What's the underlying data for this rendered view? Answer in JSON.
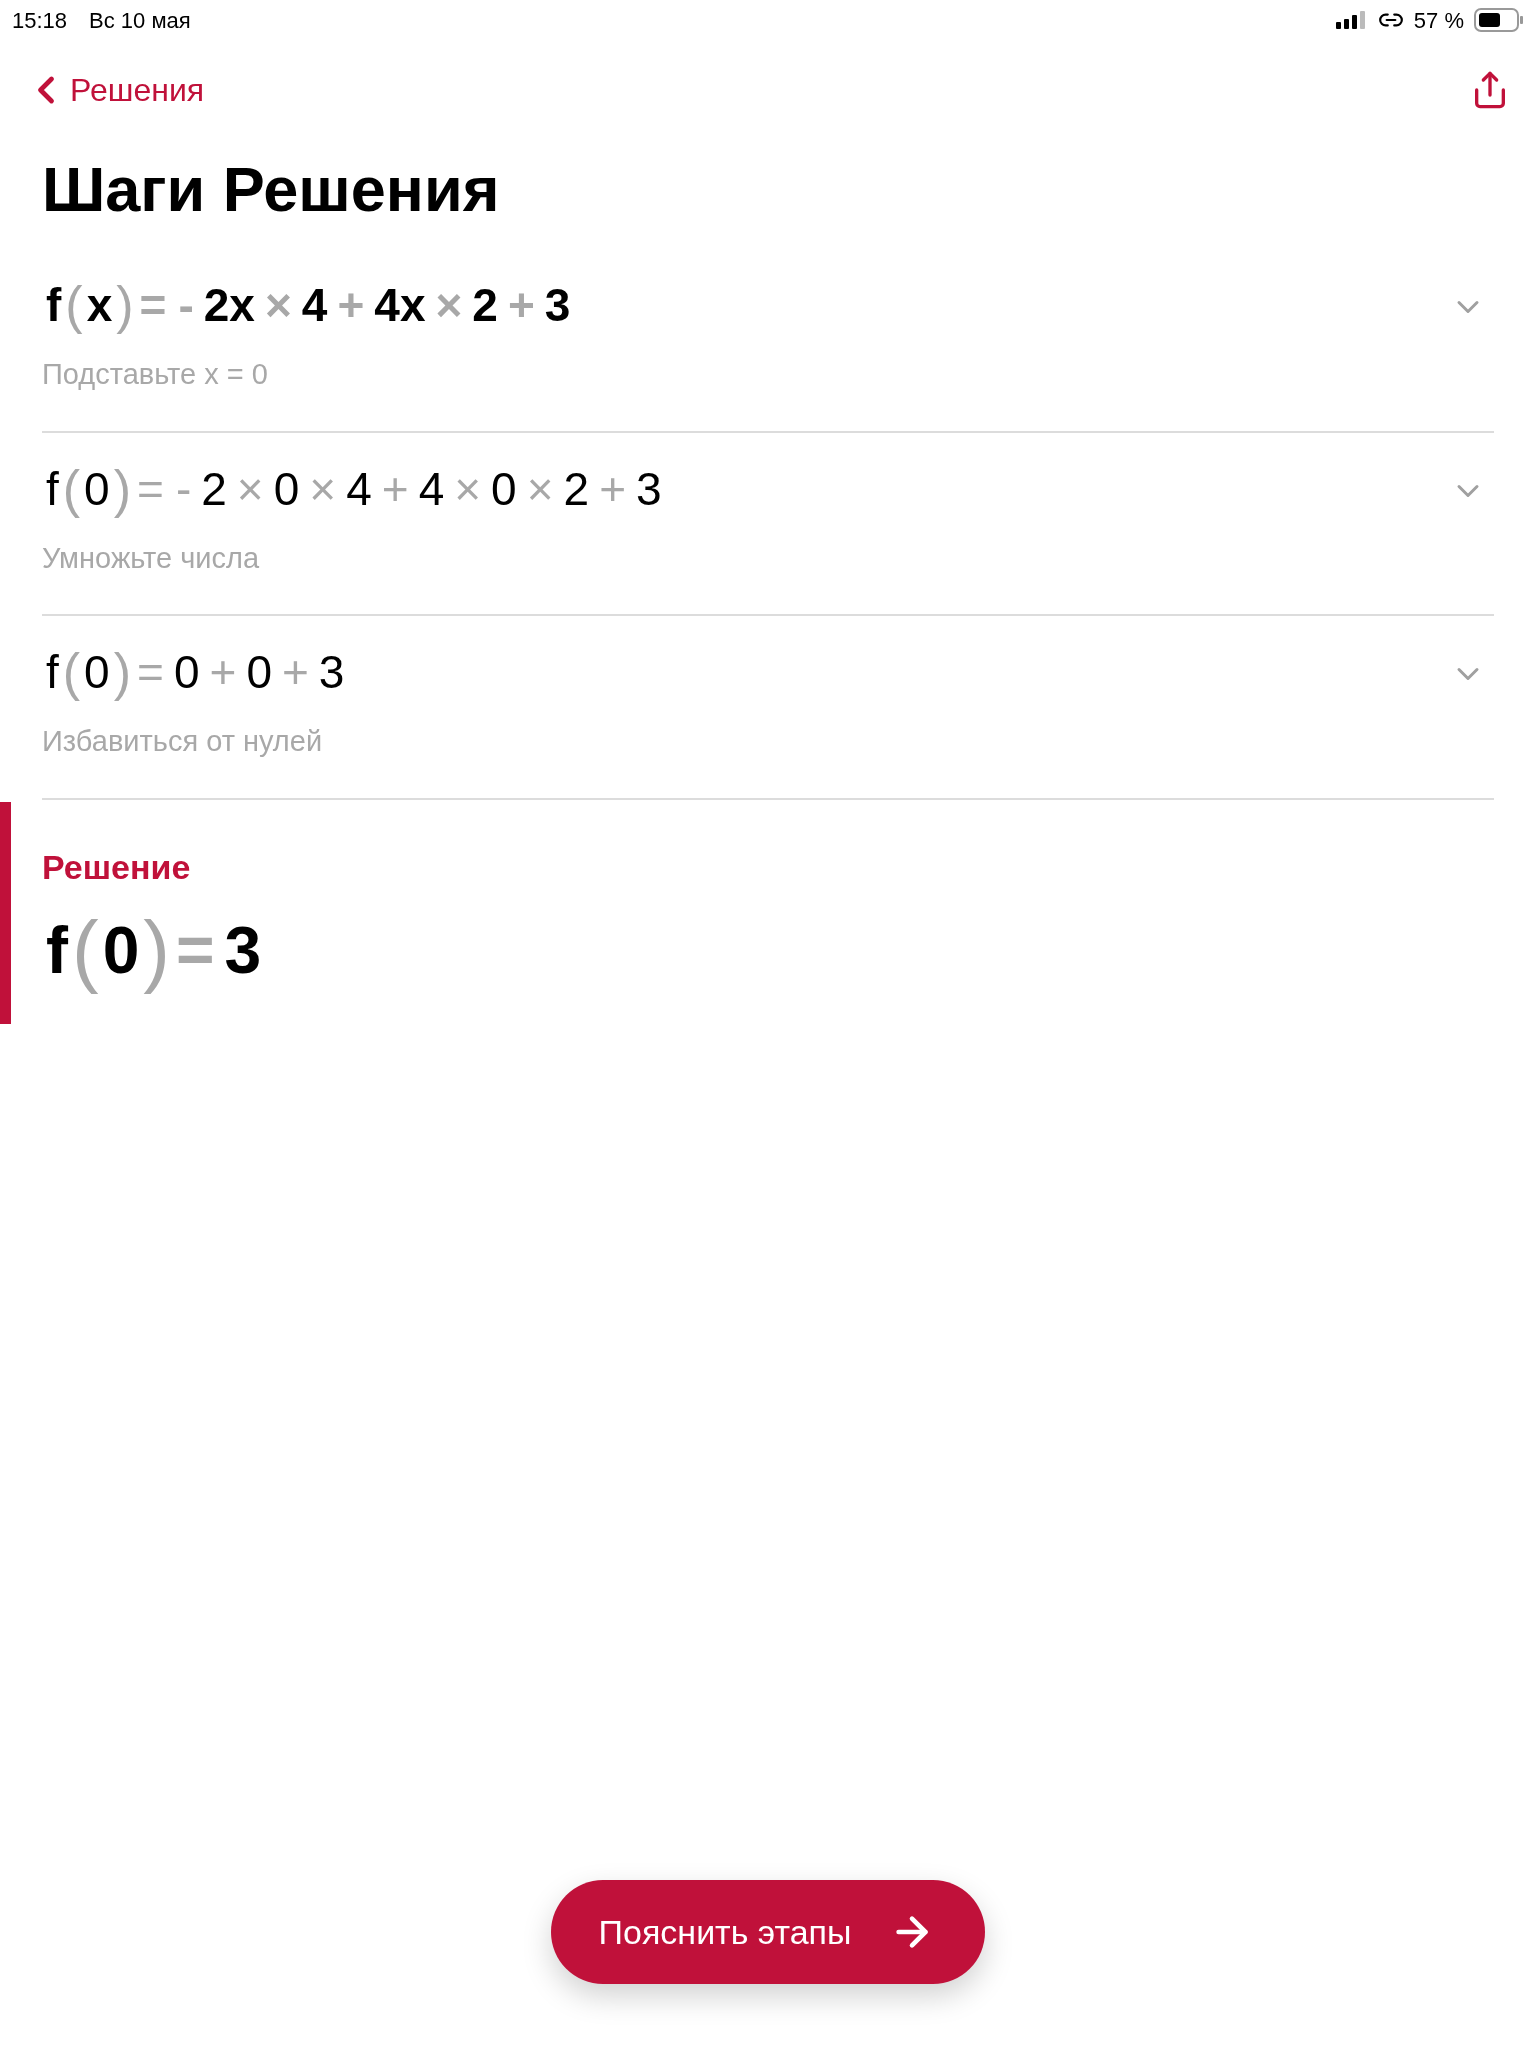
{
  "status_bar": {
    "time": "15:18",
    "date": "Вс 10 мая",
    "battery": "57 %"
  },
  "nav": {
    "back": "Решения"
  },
  "title": "Шаги Решения",
  "steps": [
    {
      "bold": true,
      "expanded": false,
      "note": "Подставьте x = 0",
      "formula": [
        {
          "kind": "term",
          "text": "f"
        },
        {
          "kind": "paren",
          "text": "("
        },
        {
          "kind": "term",
          "text": "x"
        },
        {
          "kind": "paren",
          "text": ")"
        },
        {
          "kind": "op",
          "text": "="
        },
        {
          "kind": "op",
          "text": "-"
        },
        {
          "kind": "term",
          "text": "2x"
        },
        {
          "kind": "op",
          "text": "×"
        },
        {
          "kind": "term",
          "text": "4"
        },
        {
          "kind": "op",
          "text": "+"
        },
        {
          "kind": "term",
          "text": "4x"
        },
        {
          "kind": "op",
          "text": "×"
        },
        {
          "kind": "term",
          "text": "2"
        },
        {
          "kind": "op",
          "text": "+"
        },
        {
          "kind": "term",
          "text": "3"
        }
      ]
    },
    {
      "bold": false,
      "expanded": false,
      "note": "Умножьте числа",
      "formula": [
        {
          "kind": "term",
          "text": "f"
        },
        {
          "kind": "paren",
          "text": "("
        },
        {
          "kind": "term",
          "text": "0"
        },
        {
          "kind": "paren",
          "text": ")"
        },
        {
          "kind": "op",
          "text": "="
        },
        {
          "kind": "op",
          "text": "-"
        },
        {
          "kind": "term",
          "text": "2"
        },
        {
          "kind": "op",
          "text": "×"
        },
        {
          "kind": "term",
          "text": "0"
        },
        {
          "kind": "op",
          "text": "×"
        },
        {
          "kind": "term",
          "text": "4"
        },
        {
          "kind": "op",
          "text": "+"
        },
        {
          "kind": "term",
          "text": "4"
        },
        {
          "kind": "op",
          "text": "×"
        },
        {
          "kind": "term",
          "text": "0"
        },
        {
          "kind": "op",
          "text": "×"
        },
        {
          "kind": "term",
          "text": "2"
        },
        {
          "kind": "op",
          "text": "+"
        },
        {
          "kind": "term",
          "text": "3"
        }
      ]
    },
    {
      "bold": false,
      "expanded": false,
      "note": "Избавиться от нулей",
      "formula": [
        {
          "kind": "term",
          "text": "f"
        },
        {
          "kind": "paren",
          "text": "("
        },
        {
          "kind": "term",
          "text": "0"
        },
        {
          "kind": "paren",
          "text": ")"
        },
        {
          "kind": "op",
          "text": "="
        },
        {
          "kind": "term",
          "text": "0"
        },
        {
          "kind": "op",
          "text": "+"
        },
        {
          "kind": "term",
          "text": "0"
        },
        {
          "kind": "op",
          "text": "+"
        },
        {
          "kind": "term",
          "text": "3"
        }
      ]
    }
  ],
  "solution": {
    "heading": "Решение",
    "formula": [
      {
        "kind": "term",
        "text": "f"
      },
      {
        "kind": "paren",
        "text": "("
      },
      {
        "kind": "term",
        "text": "0"
      },
      {
        "kind": "paren",
        "text": ")"
      },
      {
        "kind": "op",
        "text": "="
      },
      {
        "kind": "term",
        "text": "3"
      }
    ]
  },
  "explain_button": "Пояснить этапы"
}
